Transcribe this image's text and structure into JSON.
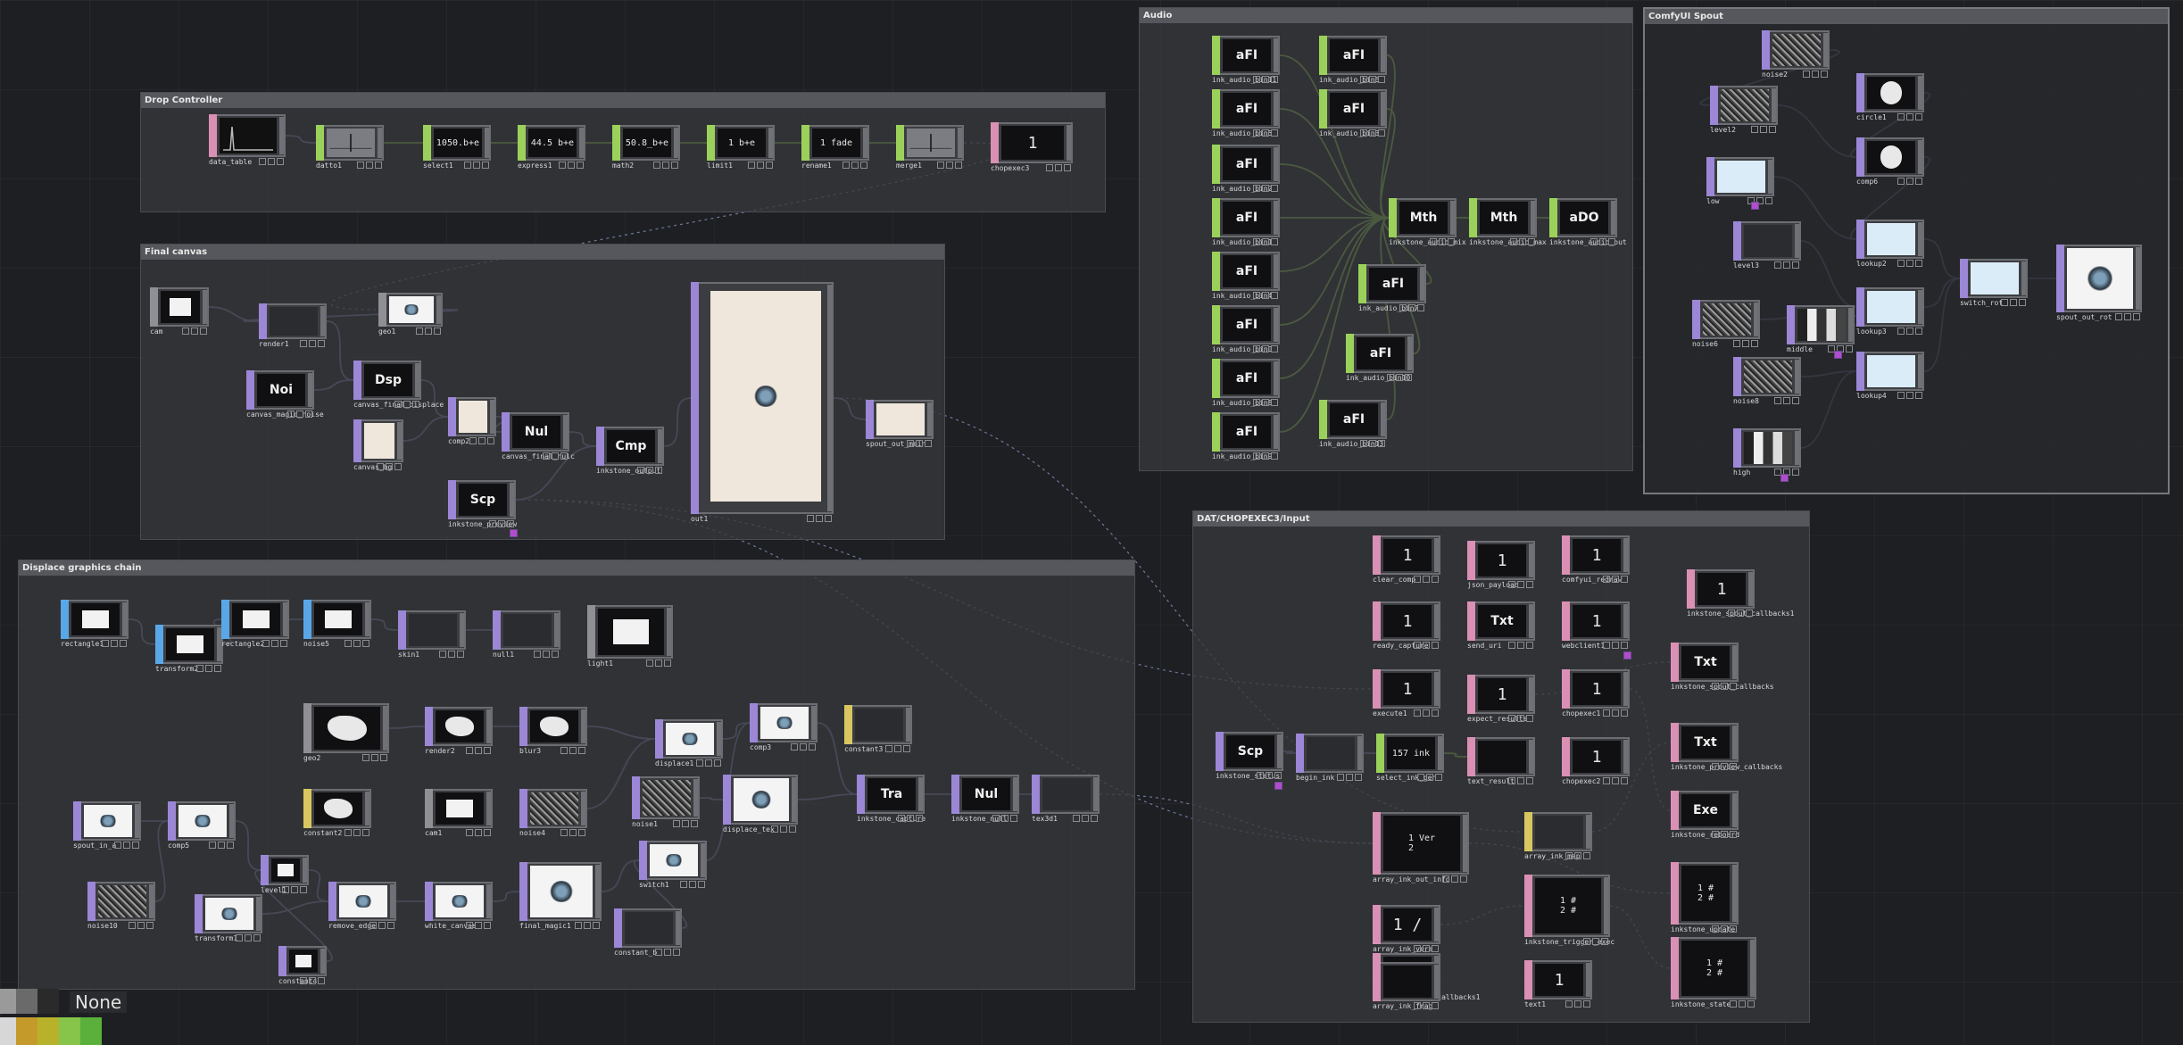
{
  "regions": [
    {
      "key": "drop",
      "title": "Drop Controller"
    },
    {
      "key": "final",
      "title": "Final canvas"
    },
    {
      "key": "displace",
      "title": "Displace graphics chain"
    },
    {
      "key": "audio",
      "title": "Audio"
    },
    {
      "key": "spout",
      "title": "ComfyUI Spout"
    },
    {
      "key": "dat",
      "title": "DAT/CHOPEXEC3/Input"
    }
  ],
  "colors": {
    "CHOP": "#9bd15a",
    "TOP": "#9b87d6",
    "SOP": "#59a7e6",
    "DAT": "#d990b4",
    "MAT": "#d8c760",
    "COMP": "#8f8f95",
    "background": "#1d1f23",
    "wire_chop": "#8fd14d",
    "wire_top": "#7a7fb0"
  },
  "nodes": [
    {
      "id": "data_table",
      "name": "data_table",
      "family": "DAT",
      "display": "chart-icon"
    },
    {
      "id": "datto1",
      "name": "datto1",
      "family": "CHOP",
      "display": "graph"
    },
    {
      "id": "select1",
      "name": "select1",
      "family": "CHOP",
      "display": "text",
      "text": "1050.b+e"
    },
    {
      "id": "express1",
      "name": "express1",
      "family": "CHOP",
      "display": "text",
      "text": "44.5 b+e"
    },
    {
      "id": "math2",
      "name": "math2",
      "family": "CHOP",
      "display": "text",
      "text": "50.8_b+e"
    },
    {
      "id": "limit1",
      "name": "limit1",
      "family": "CHOP",
      "display": "text",
      "text": "1 b+e"
    },
    {
      "id": "rename1",
      "name": "rename1",
      "family": "CHOP",
      "display": "text",
      "text": "1 fade"
    },
    {
      "id": "merge1",
      "name": "merge1",
      "family": "CHOP",
      "display": "graph"
    },
    {
      "id": "chopexec3",
      "name": "chopexec3",
      "family": "DAT",
      "display": "num",
      "text": "1"
    },
    {
      "id": "cam",
      "name": "cam",
      "family": "COMP",
      "display": "img"
    },
    {
      "id": "render1",
      "name": "render1",
      "family": "TOP",
      "display": "img"
    },
    {
      "id": "geo1",
      "name": "geo1",
      "family": "COMP",
      "display": "img"
    },
    {
      "id": "noi",
      "name": "canvas_magic_noise",
      "family": "TOP",
      "display": "op",
      "text": "Noi"
    },
    {
      "id": "dsp",
      "name": "canvas_final_displace",
      "family": "TOP",
      "display": "op",
      "text": "Dsp"
    },
    {
      "id": "comp2",
      "name": "comp2",
      "family": "TOP",
      "display": "img"
    },
    {
      "id": "canvas_bg",
      "name": "canvas_bg",
      "family": "TOP",
      "display": "img"
    },
    {
      "id": "nul",
      "name": "canvas_final_nulc",
      "family": "TOP",
      "display": "op",
      "text": "Nul"
    },
    {
      "id": "cmp",
      "name": "inkstone_output",
      "family": "TOP",
      "display": "op",
      "text": "Cmp"
    },
    {
      "id": "scp1",
      "name": "inkstone_preview",
      "family": "TOP",
      "display": "op",
      "text": "Scp"
    },
    {
      "id": "out1",
      "name": "out1",
      "family": "TOP",
      "display": "canvas"
    },
    {
      "id": "spout_out",
      "name": "spout_out_main",
      "family": "TOP",
      "display": "img"
    },
    {
      "id": "rect1",
      "name": "rectangle1",
      "family": "SOP",
      "display": "img"
    },
    {
      "id": "transform2",
      "name": "transform2",
      "family": "SOP",
      "display": "img"
    },
    {
      "id": "rect2",
      "name": "rectangle2",
      "family": "SOP",
      "display": "img"
    },
    {
      "id": "noise5",
      "name": "noise5",
      "family": "SOP",
      "display": "img"
    },
    {
      "id": "skin1",
      "name": "skin1",
      "family": "TOP",
      "display": "img"
    },
    {
      "id": "null1",
      "name": "null1",
      "family": "TOP",
      "display": "img"
    },
    {
      "id": "light1",
      "name": "light1",
      "family": "COMP",
      "display": "img"
    },
    {
      "id": "geo2",
      "name": "geo2",
      "family": "COMP",
      "display": "img"
    },
    {
      "id": "render2",
      "name": "render2",
      "family": "TOP",
      "display": "img"
    },
    {
      "id": "blur3",
      "name": "blur3",
      "family": "TOP",
      "display": "img"
    },
    {
      "id": "displace1",
      "name": "displace1",
      "family": "TOP",
      "display": "img"
    },
    {
      "id": "comp3",
      "name": "comp3",
      "family": "TOP",
      "display": "img"
    },
    {
      "id": "constant3",
      "name": "constant3",
      "family": "MAT",
      "display": "img"
    },
    {
      "id": "constant2",
      "name": "constant2",
      "family": "MAT",
      "display": "img"
    },
    {
      "id": "cam1",
      "name": "cam1",
      "family": "COMP",
      "display": "img"
    },
    {
      "id": "noise4",
      "name": "noise4",
      "family": "TOP",
      "display": "img"
    },
    {
      "id": "noise1",
      "name": "noise1",
      "family": "TOP",
      "display": "img"
    },
    {
      "id": "displace_tex",
      "name": "displace_tex",
      "family": "TOP",
      "display": "img"
    },
    {
      "id": "tra",
      "name": "inkstone_capture",
      "family": "TOP",
      "display": "op",
      "text": "Tra"
    },
    {
      "id": "nul2",
      "name": "inkstone_null",
      "family": "TOP",
      "display": "op",
      "text": "Nul"
    },
    {
      "id": "tex3d",
      "name": "tex3d1",
      "family": "TOP",
      "display": "img"
    },
    {
      "id": "spout_in",
      "name": "spout_in_a",
      "family": "TOP",
      "display": "img"
    },
    {
      "id": "comp5",
      "name": "comp5",
      "family": "TOP",
      "display": "img"
    },
    {
      "id": "level1",
      "name": "level1",
      "family": "TOP",
      "display": "img"
    },
    {
      "id": "remove_edge",
      "name": "remove_edge",
      "family": "TOP",
      "display": "img"
    },
    {
      "id": "white_canvas",
      "name": "white_canvas",
      "family": "TOP",
      "display": "img"
    },
    {
      "id": "final_magic",
      "name": "final_magic1",
      "family": "TOP",
      "display": "img"
    },
    {
      "id": "switch1",
      "name": "switch1",
      "family": "TOP",
      "display": "img"
    },
    {
      "id": "noise10",
      "name": "noise10",
      "family": "TOP",
      "display": "img"
    },
    {
      "id": "transform1",
      "name": "transform1",
      "family": "TOP",
      "display": "img"
    },
    {
      "id": "constant4",
      "name": "constant4",
      "family": "TOP",
      "display": "img"
    },
    {
      "id": "constant_b",
      "name": "constant_b",
      "family": "TOP",
      "display": "img"
    },
    {
      "id": "afi1",
      "name": "ink_audio_bin11",
      "family": "CHOP",
      "display": "op",
      "text": "aFI"
    },
    {
      "id": "afi2",
      "name": "ink_audio_bin5",
      "family": "CHOP",
      "display": "op",
      "text": "aFI"
    },
    {
      "id": "afi3",
      "name": "ink_audio_bin2",
      "family": "CHOP",
      "display": "op",
      "text": "aFI"
    },
    {
      "id": "afi4",
      "name": "ink_audio_bin1",
      "family": "CHOP",
      "display": "op",
      "text": "aFI"
    },
    {
      "id": "afi5",
      "name": "ink_audio_bin4",
      "family": "CHOP",
      "display": "op",
      "text": "aFI"
    },
    {
      "id": "afi6",
      "name": "ink_audio_bin0",
      "family": "CHOP",
      "display": "op",
      "text": "aFI"
    },
    {
      "id": "afi7",
      "name": "ink_audio_bin8",
      "family": "CHOP",
      "display": "op",
      "text": "aFI"
    },
    {
      "id": "afi8",
      "name": "ink_audio_bin9",
      "family": "CHOP",
      "display": "op",
      "text": "aFI"
    },
    {
      "id": "afi9",
      "name": "ink_audio_bin6",
      "family": "CHOP",
      "display": "op",
      "text": "aFI"
    },
    {
      "id": "afi10",
      "name": "ink_audio_bin3",
      "family": "CHOP",
      "display": "op",
      "text": "aFI"
    },
    {
      "id": "afi11",
      "name": "ink_audio_bin7",
      "family": "CHOP",
      "display": "op",
      "text": "aFI"
    },
    {
      "id": "afi12",
      "name": "ink_audio_bin10",
      "family": "CHOP",
      "display": "op",
      "text": "aFI"
    },
    {
      "id": "afi13",
      "name": "ink_audio_bin13",
      "family": "CHOP",
      "display": "op",
      "text": "aFI"
    },
    {
      "id": "mth1",
      "name": "inkstone_audio_mix",
      "family": "CHOP",
      "display": "op",
      "text": "Mth"
    },
    {
      "id": "mth2",
      "name": "inkstone_audio_max",
      "family": "CHOP",
      "display": "op",
      "text": "Mth"
    },
    {
      "id": "ado",
      "name": "inkstone_audio_out",
      "family": "CHOP",
      "display": "op",
      "text": "aDO"
    },
    {
      "id": "noise2",
      "name": "noise2",
      "family": "TOP",
      "display": "img"
    },
    {
      "id": "circle1",
      "name": "circle1",
      "family": "TOP",
      "display": "img"
    },
    {
      "id": "level2",
      "name": "level2",
      "family": "TOP",
      "display": "img"
    },
    {
      "id": "comp6",
      "name": "comp6",
      "family": "TOP",
      "display": "img"
    },
    {
      "id": "low",
      "name": "low",
      "family": "TOP",
      "display": "img"
    },
    {
      "id": "lookup2",
      "name": "lookup2",
      "family": "TOP",
      "display": "img"
    },
    {
      "id": "level3",
      "name": "level3",
      "family": "TOP",
      "display": "img"
    },
    {
      "id": "lookup3",
      "name": "lookup3",
      "family": "TOP",
      "display": "img"
    },
    {
      "id": "switch_rot",
      "name": "switch_rot",
      "family": "TOP",
      "display": "img"
    },
    {
      "id": "spout_out_rot",
      "name": "spout_out_rot",
      "family": "TOP",
      "display": "img"
    },
    {
      "id": "noise6",
      "name": "noise6",
      "family": "TOP",
      "display": "img"
    },
    {
      "id": "middle",
      "name": "middle",
      "family": "TOP",
      "display": "img"
    },
    {
      "id": "noise8",
      "name": "noise8",
      "family": "TOP",
      "display": "img"
    },
    {
      "id": "lookup4",
      "name": "lookup4",
      "family": "TOP",
      "display": "img"
    },
    {
      "id": "high",
      "name": "high",
      "family": "TOP",
      "display": "img"
    },
    {
      "id": "clear_comp",
      "name": "clear_comp",
      "family": "DAT",
      "display": "num",
      "text": "1"
    },
    {
      "id": "json_payload",
      "name": "json_payload",
      "family": "DAT",
      "display": "num",
      "text": "1"
    },
    {
      "id": "comfy_redraw",
      "name": "comfyui_redraw",
      "family": "DAT",
      "display": "num",
      "text": "1"
    },
    {
      "id": "ink_cb1",
      "name": "inkstone_spout_callbacks1",
      "family": "DAT",
      "display": "num",
      "text": "1"
    },
    {
      "id": "ready_capture",
      "name": "ready_capture",
      "family": "DAT",
      "display": "num",
      "text": "1"
    },
    {
      "id": "send_uri",
      "name": "send_uri",
      "family": "DAT",
      "display": "op",
      "text": "Txt"
    },
    {
      "id": "webclient1",
      "name": "webclient1",
      "family": "DAT",
      "display": "num",
      "text": "1"
    },
    {
      "id": "ink_cb2",
      "name": "inkstone_spout_callbacks",
      "family": "DAT",
      "display": "op",
      "text": "Txt"
    },
    {
      "id": "execute1",
      "name": "execute1",
      "family": "DAT",
      "display": "num",
      "text": "1"
    },
    {
      "id": "expect_results",
      "name": "expect_results",
      "family": "DAT",
      "display": "num",
      "text": "1"
    },
    {
      "id": "chopexec1",
      "name": "chopexec1",
      "family": "DAT",
      "display": "num",
      "text": "1"
    },
    {
      "id": "ink_cb3",
      "name": "inkstone_preview_callbacks",
      "family": "DAT",
      "display": "op",
      "text": "Txt"
    },
    {
      "id": "scp2",
      "name": "inkstone_status",
      "family": "TOP",
      "display": "op",
      "text": "Scp"
    },
    {
      "id": "begin_ink",
      "name": "begin_ink",
      "family": "TOP",
      "display": "img"
    },
    {
      "id": "select_ink",
      "name": "select_ink_gen",
      "family": "CHOP",
      "display": "text",
      "text": "157 ink"
    },
    {
      "id": "text_result",
      "name": "text_result",
      "family": "DAT",
      "display": "num",
      "text": ""
    },
    {
      "id": "chopexec2",
      "name": "chopexec2",
      "family": "DAT",
      "display": "num",
      "text": "1"
    },
    {
      "id": "ink_exec",
      "name": "inkstone_reboard",
      "family": "DAT",
      "display": "op",
      "text": "Exe"
    },
    {
      "id": "array_ver",
      "name": "array_ink_out_info",
      "family": "DAT",
      "display": "text",
      "text": "1 Ver\n2"
    },
    {
      "id": "array_ink",
      "name": "array_ink_map",
      "family": "MAT",
      "display": "img"
    },
    {
      "id": "ink_update",
      "name": "inkstone_update",
      "family": "DAT",
      "display": "text",
      "text": "1 #\n2 #"
    },
    {
      "id": "array_vers",
      "name": "array_ink_vers",
      "family": "DAT",
      "display": "num",
      "text": "1 /"
    },
    {
      "id": "ink_trigger",
      "name": "inkstone_trigger_exec",
      "family": "DAT",
      "display": "text",
      "text": "1 #\n2 #"
    },
    {
      "id": "ink_cb4",
      "name": "inkstone_spout_callbacks1",
      "family": "DAT",
      "display": "num",
      "text": "1"
    },
    {
      "id": "array_frag",
      "name": "array_ink_frag",
      "family": "DAT",
      "display": "num",
      "text": ""
    },
    {
      "id": "text1",
      "name": "text1",
      "family": "DAT",
      "display": "num",
      "text": "1"
    },
    {
      "id": "ink_state",
      "name": "inkstone_state",
      "family": "DAT",
      "display": "text",
      "text": "1 #\n2 #"
    }
  ],
  "palette": {
    "swatches": [
      "#9a9a9a",
      "#6a6a6a",
      "#2a2a2a",
      "#d7d7d7",
      "#c49a2a",
      "#b8b22a",
      "#86c44a",
      "#5ab03a"
    ],
    "label": "None"
  }
}
